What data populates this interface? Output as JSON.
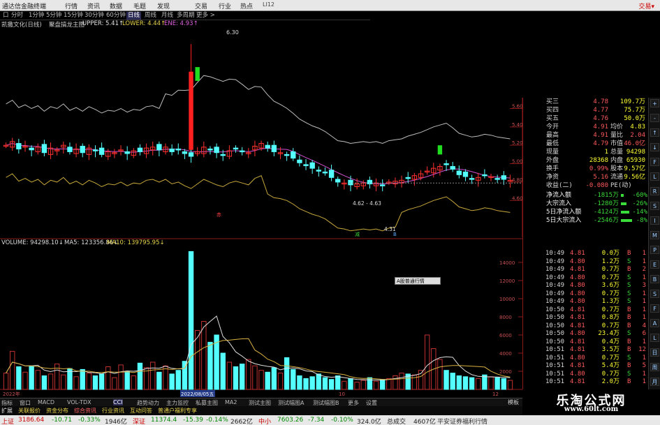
{
  "title_bar": {
    "app": "通达信金融终端",
    "menus": [
      "行情",
      "资讯",
      "数据",
      "毛题",
      "发现",
      "交易",
      "行业",
      "热点"
    ],
    "user": "LI12",
    "trade": "交易▾"
  },
  "period_bar": {
    "items": [
      "口",
      "分时",
      "1分钟",
      "5分钟",
      "15分钟",
      "30分钟",
      "60分钟",
      "日线",
      "周线",
      "月线",
      "多周期",
      "更多 >"
    ],
    "active": "日线"
  },
  "main_info": {
    "stock": "凯撒文化(日线)",
    "indicator": "聚盘搞龙主图",
    "upper": "UPPER: 5.41↑",
    "lower": "LOWER: 4.44↑",
    "ene": "ENE: 4.93↑"
  },
  "vol_info": {
    "volume": "VOLUME: 94298.10↓",
    "ma5": "MA5: 123356.86↓",
    "ma10": "MA10: 139795.95↓"
  },
  "price_axis": {
    "labels": [
      "5.60",
      "5.40",
      "5.20",
      "5.00",
      "4.80",
      "4.60"
    ],
    "current": "4.40"
  },
  "vol_axis": {
    "labels": [
      "14000",
      "12000",
      "10000",
      "8000",
      "6000",
      "4000",
      "2000"
    ]
  },
  "chart_annotations": {
    "high": "6.30",
    "range": "4.62 - 4.63",
    "low": "4.31",
    "red_mark": "赤",
    "green_mark": "减",
    "blue_mark": "B"
  },
  "date_axis": {
    "labels": [
      "2022年",
      "2022/08/05五",
      "10",
      "12"
    ],
    "legend": "日K"
  },
  "quote_panel": {
    "rows": [
      {
        "label": "买三",
        "v1": "4.78",
        "l2": "",
        "v2": "109.7万"
      },
      {
        "label": "买四",
        "v1": "4.77",
        "l2": "",
        "v2": "75.7万"
      },
      {
        "label": "买五",
        "v1": "4.76",
        "l2": "",
        "v2": "50.0万"
      },
      {
        "label": "今开",
        "v1": "4.91",
        "l2": "均价",
        "v2": "4.83"
      },
      {
        "label": "最高",
        "v1": "4.91",
        "l2": "量比",
        "v2": "2.04"
      },
      {
        "label": "最低",
        "v1": "4.79",
        "l2": "市值",
        "v2": "46.0亿"
      },
      {
        "label": "现量",
        "v1": "1",
        "l2": "总量",
        "v2": "94298"
      },
      {
        "label": "外盘",
        "v1": "28368",
        "l2": "内盘",
        "v2": "65930"
      },
      {
        "label": "换手",
        "v1": "0.99%",
        "l2": "股本",
        "v2": "9.57亿"
      },
      {
        "label": "净资",
        "v1": "5.16",
        "l2": "流通",
        "v2": "9.56亿"
      },
      {
        "label": "收益(二)",
        "v1": "-0.080",
        "l2": "PE(动)",
        "v2": ""
      }
    ],
    "flows": [
      {
        "label": "净流入额",
        "v": "-1815万",
        "p": "-60%"
      },
      {
        "label": "大宗流入",
        "v": "-1280万",
        "p": "-26%"
      },
      {
        "label": "5日净流入额",
        "v": "-4124万",
        "p": "-14%"
      },
      {
        "label": "5日大宗流入",
        "v": "-2546万",
        "p": "-8%"
      }
    ]
  },
  "ticks": [
    {
      "t": "10:49",
      "p": "4.81",
      "q": "0.0万",
      "bs": "B",
      "n": "1"
    },
    {
      "t": "10:49",
      "p": "4.80",
      "q": "1.2万",
      "bs": "S",
      "n": "1"
    },
    {
      "t": "10:49",
      "p": "4.81",
      "q": "0.7万",
      "bs": "B",
      "n": "2"
    },
    {
      "t": "10:49",
      "p": "4.80",
      "q": "0.7万",
      "bs": "S",
      "n": "1"
    },
    {
      "t": "10:49",
      "p": "4.80",
      "q": "3.6万",
      "bs": "S",
      "n": "3"
    },
    {
      "t": "10:49",
      "p": "4.80",
      "q": "0.7万",
      "bs": "S",
      "n": "1"
    },
    {
      "t": "10:49",
      "p": "4.80",
      "q": "1.3万",
      "bs": "S",
      "n": "1"
    },
    {
      "t": "10:50",
      "p": "4.81",
      "q": "0.7万",
      "bs": "B",
      "n": "1"
    },
    {
      "t": "10:50",
      "p": "4.81",
      "q": "0.8万",
      "bs": "B",
      "n": "1"
    },
    {
      "t": "10:50",
      "p": "4.81",
      "q": "0.7万",
      "bs": "B",
      "n": "4"
    },
    {
      "t": "10:50",
      "p": "4.80",
      "q": "23.4万",
      "bs": "S",
      "n": "6"
    },
    {
      "t": "10:50",
      "p": "4.81",
      "q": "0.4万",
      "bs": "B",
      "n": "1"
    },
    {
      "t": "10:51",
      "p": "4.81",
      "q": "3.5万",
      "bs": "B",
      "n": "12"
    },
    {
      "t": "10:51",
      "p": "4.80",
      "q": "0.7万",
      "bs": "S",
      "n": "1"
    },
    {
      "t": "10:51",
      "p": "4.81",
      "q": "5.4万",
      "bs": "B",
      "n": "5"
    },
    {
      "t": "10:51",
      "p": "4.80",
      "q": "0.7万",
      "bs": "S",
      "n": "1"
    },
    {
      "t": "10:51",
      "p": "4.81",
      "q": "2.0万",
      "bs": "B",
      "n": "1"
    }
  ],
  "side_tabs": [
    "+",
    "-",
    "↑",
    "↓",
    "F",
    "L",
    "R",
    "S",
    "I",
    "M",
    "P",
    "E",
    "B",
    "S",
    "F",
    "A",
    "L",
    "日",
    "周",
    "月"
  ],
  "bottom_tabs": [
    "指标",
    "窗口",
    "MACD",
    "VOL-TDX",
    "CCI",
    "趋势动力",
    "主力监控",
    "私募主图",
    "MA2",
    "测试主图",
    "测试幅图A",
    "测试幅图B",
    "更多",
    "设置"
  ],
  "bottom_tabs2": [
    "扩展",
    "关联报价",
    "资金分布",
    "综合资讯",
    "行业资讯",
    "互动问答",
    "普通户福利专享"
  ],
  "bottom_right": "模板",
  "popup": "A股普通行情",
  "index_bar": {
    "sh_label": "上证",
    "sh_val": "3186.64",
    "sh_chg": "-10.71",
    "sh_pct": "-0.33%",
    "sh_amt": "1946亿",
    "sz_label": "深证",
    "sz_val": "11374.4",
    "sz_chg": "-15.39",
    "sz_pct": "-0.14%",
    "sz_amt": "2662亿",
    "zx_label": "中小",
    "zx_val": "7603.26",
    "zx_chg": "-7.34",
    "zx_pct": "-0.10%",
    "zx_amt": "324.0亿",
    "total_label": "总成交",
    "total_amt": "4607亿",
    "broker": "平安证券福利行情"
  },
  "watermark": {
    "cn": "乐淘公式网",
    "url": "www.60lt.com"
  },
  "chart_data": {
    "type": "candlestick",
    "price_axis": [
      4.4,
      5.6
    ],
    "closes": [
      5.2,
      5.24,
      5.16,
      5.19,
      5.15,
      5.18,
      5.12,
      5.17,
      5.15,
      5.2,
      5.13,
      5.16,
      5.12,
      5.17,
      5.14,
      5.1,
      5.13,
      5.12,
      5.15,
      5.11,
      5.14,
      5.13,
      5.17,
      5.18,
      5.15,
      5.18,
      5.13,
      5.15,
      5.11,
      5.08,
      5.13,
      5.18,
      5.15,
      5.12,
      5.1,
      5.14,
      5.16,
      5.14,
      5.12,
      5.19,
      5.22,
      5.17,
      5.13,
      5.12,
      5.1,
      5.06,
      5.01,
      4.98,
      4.95,
      4.93,
      4.9,
      4.85,
      4.8,
      4.79,
      4.77,
      4.78,
      4.79,
      4.78,
      4.79,
      4.77,
      4.8,
      4.81,
      4.82,
      4.85,
      4.87,
      4.89,
      4.92,
      4.95,
      4.97,
      4.99,
      4.94,
      4.88,
      4.86,
      4.84,
      4.85,
      4.87,
      4.86,
      4.84,
      4.83,
      4.82
    ],
    "volumes": [
      1800,
      4200,
      2500,
      1900,
      2600,
      2100,
      1500,
      1700,
      2800,
      1600,
      2300,
      1400,
      2200,
      1800,
      1500,
      1700,
      2500,
      1300,
      2700,
      2000,
      1500,
      2900,
      2400,
      3000,
      1900,
      2600,
      1700,
      2100,
      3100,
      15200,
      6500,
      7500,
      5200,
      6000,
      4000,
      3000,
      2500,
      2800,
      3300,
      2600,
      2100,
      1900,
      2400,
      1800,
      3500,
      2200,
      1500,
      1200,
      1400,
      1700,
      1300,
      1100,
      1500,
      900,
      1200,
      800,
      1000,
      1300,
      900,
      1100,
      1200,
      1500,
      1800,
      1700,
      1600,
      2100,
      6000,
      4500,
      3300,
      2100,
      1800,
      1500,
      1400,
      1300,
      1200,
      1600,
      1400,
      1300,
      1200,
      1000
    ],
    "upper_band": "UPPER",
    "lower_band": "LOWER",
    "mid_band": "ENE"
  }
}
